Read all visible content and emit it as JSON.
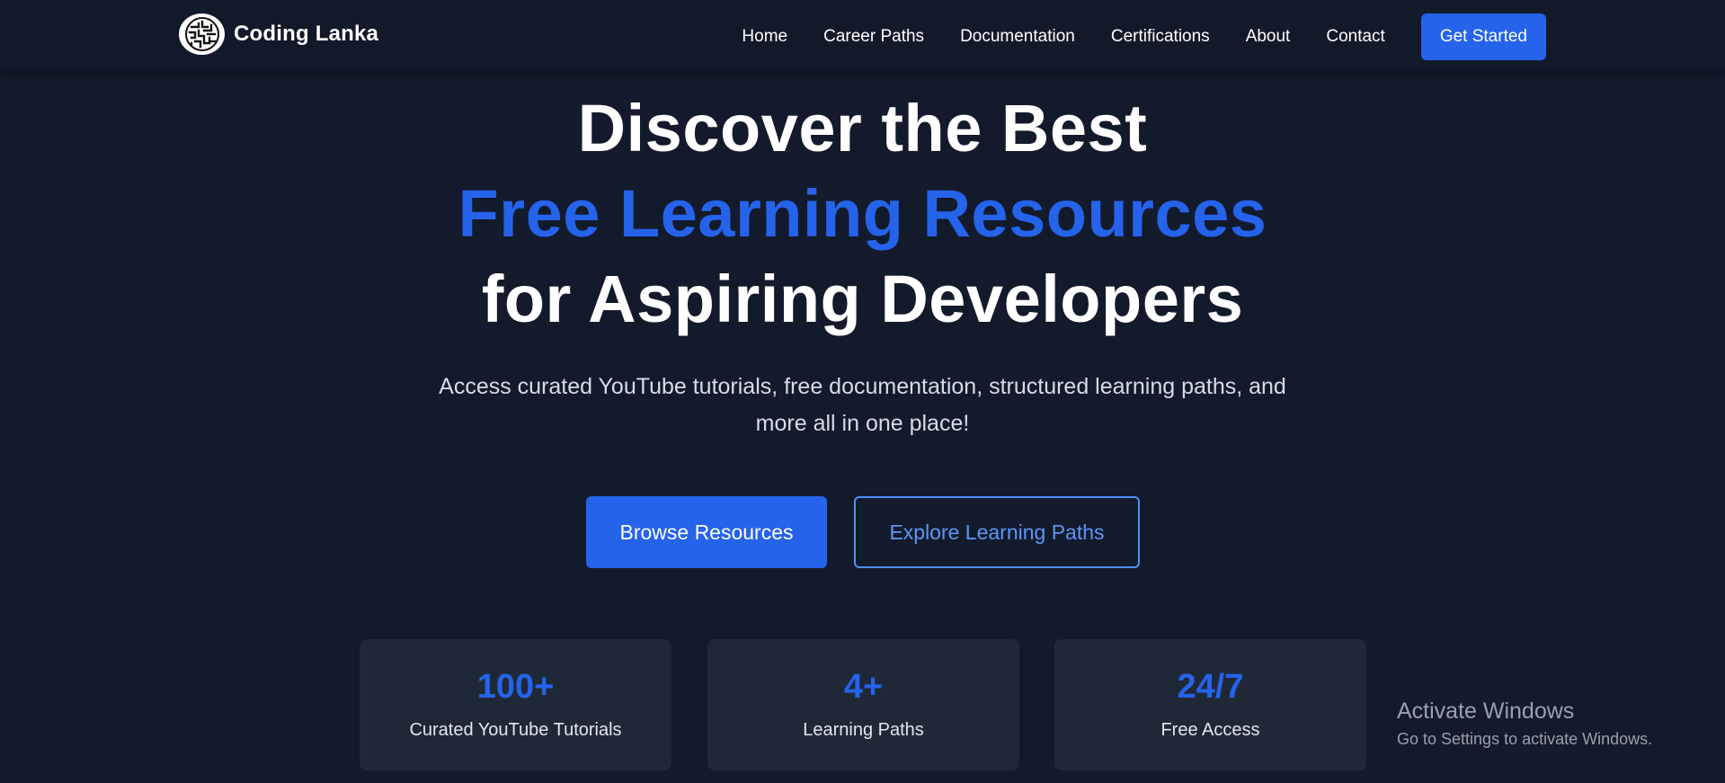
{
  "nav": {
    "brand": "Coding Lanka",
    "links": [
      "Home",
      "Career Paths",
      "Documentation",
      "Certifications",
      "About",
      "Contact"
    ],
    "cta": "Get Started"
  },
  "hero": {
    "line1": "Discover the Best",
    "line2": "Free Learning Resources",
    "line3": "for Aspiring Developers",
    "subtitle": "Access curated YouTube tutorials, free documentation, structured learning paths, and more all in one place!",
    "primary_button": "Browse Resources",
    "secondary_button": "Explore Learning Paths"
  },
  "stats": [
    {
      "value": "100+",
      "label": "Curated YouTube Tutorials"
    },
    {
      "value": "4+",
      "label": "Learning Paths"
    },
    {
      "value": "24/7",
      "label": "Free Access"
    }
  ],
  "watermark": {
    "title": "Activate Windows",
    "subtitle": "Go to Settings to activate Windows."
  },
  "colors": {
    "background": "#131a2b",
    "accent": "#2563eb",
    "card": "#1f2837"
  },
  "icons": {
    "logo": "maze-logo-icon"
  }
}
